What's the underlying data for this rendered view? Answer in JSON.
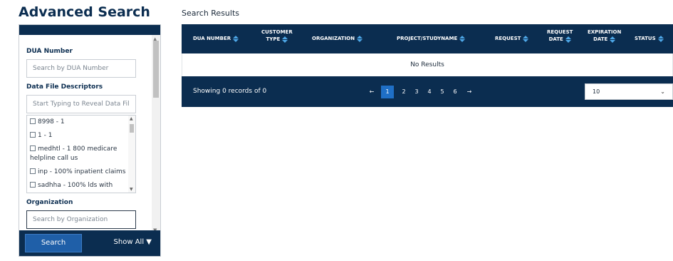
{
  "sidebar": {
    "title": "Advanced Search",
    "dua_label": "DUA Number",
    "dua_placeholder": "Search by DUA Number",
    "descriptors_label": "Data File Descriptors",
    "descriptors_placeholder": "Start Typing to Reveal Data Files..",
    "descriptors_items": [
      "8998 - 1",
      "1 - 1",
      "medhtl - 1 800 medicare helpline call us",
      "inp - 100% inpatient claims",
      "sadhha - 100% lds with"
    ],
    "organization_label": "Organization",
    "organization_placeholder": "Search by Organization",
    "search_button": "Search",
    "show_all": "Show All"
  },
  "results": {
    "title": "Search Results",
    "columns": [
      {
        "line1": "DUA NUMBER",
        "line2": ""
      },
      {
        "line1": "CUSTOMER",
        "line2": "TYPE"
      },
      {
        "line1": "ORGANIZATION",
        "line2": ""
      },
      {
        "line1": "PROJECT/STUDYNAME",
        "line2": ""
      },
      {
        "line1": "REQUEST",
        "line2": ""
      },
      {
        "line1": "REQUEST",
        "line2": "DATE"
      },
      {
        "line1": "EXPIRATION",
        "line2": "DATE"
      },
      {
        "line1": "STATUS",
        "line2": ""
      }
    ],
    "empty_message": "No Results",
    "showing": "Showing 0 records of 0",
    "pagination": {
      "prev": "←",
      "pages": [
        "1",
        "2",
        "3",
        "4",
        "5",
        "6"
      ],
      "current": "1",
      "next": "→"
    },
    "per_page": "10"
  },
  "colors": {
    "navy": "#0b2d50",
    "accent_blue": "#1f6fc6",
    "sort_arrow": "#4ea8e8"
  }
}
